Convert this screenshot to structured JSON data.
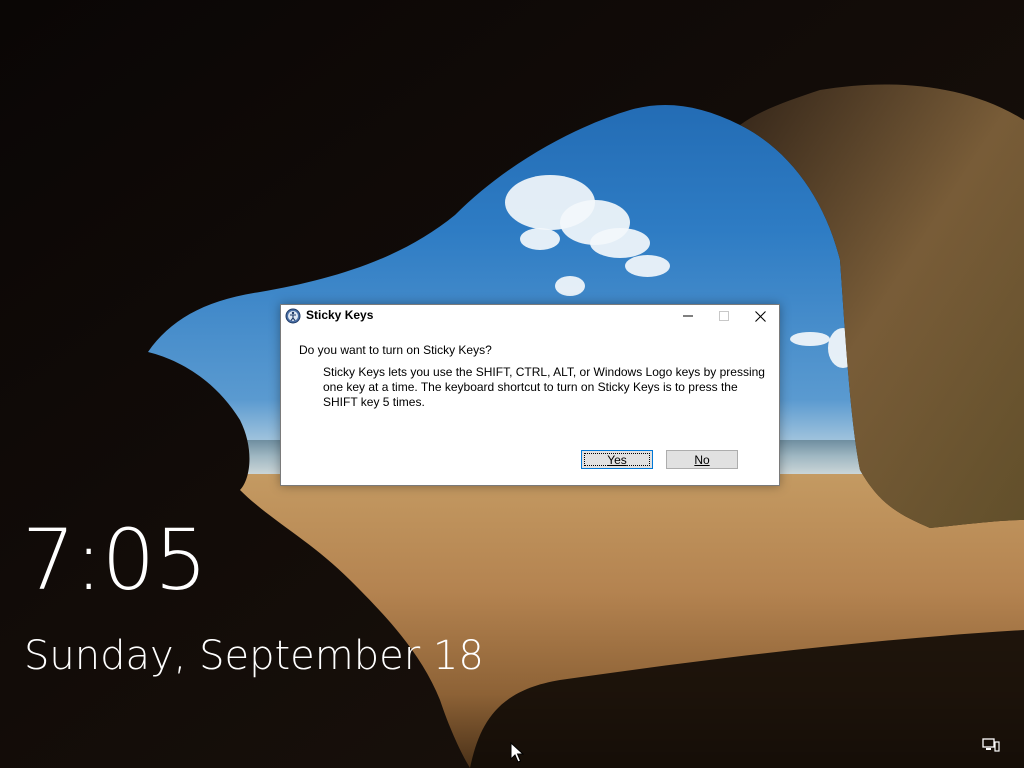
{
  "lockscreen": {
    "time": "7:05",
    "date": "Sunday, September 18"
  },
  "dialog": {
    "title": "Sticky Keys",
    "question": "Do you want to turn on Sticky Keys?",
    "description": "Sticky Keys lets you use the SHIFT, CTRL, ALT, or Windows Logo keys by pressing one key at a time. The keyboard shortcut to turn on Sticky Keys is to press the SHIFT key 5 times.",
    "buttons": {
      "yes": "Yes",
      "no": "No"
    },
    "controls": {
      "minimize_icon": "minimize-icon",
      "maximize_icon": "maximize-icon",
      "close_icon": "close-icon"
    },
    "title_icon": "ease-of-access-icon"
  },
  "tray": {
    "network_icon": "network-icon"
  },
  "colors": {
    "dialog_bg": "#ffffff",
    "button_bg": "#e1e1e1",
    "button_focus_border": "#0078d7",
    "clock_text": "#ffffff"
  }
}
